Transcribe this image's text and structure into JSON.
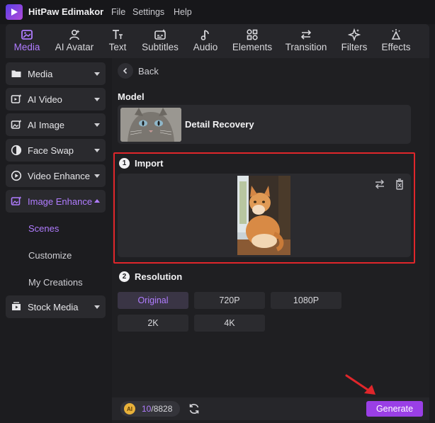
{
  "app": {
    "name": "HitPaw Edimakor"
  },
  "menu": [
    "File",
    "Settings",
    "Help"
  ],
  "tools": [
    {
      "label": "Media",
      "icon": "media-icon",
      "active": true
    },
    {
      "label": "AI Avatar",
      "icon": "ai-avatar-icon"
    },
    {
      "label": "Text",
      "icon": "text-icon"
    },
    {
      "label": "Subtitles",
      "icon": "subtitles-icon"
    },
    {
      "label": "Audio",
      "icon": "audio-icon"
    },
    {
      "label": "Elements",
      "icon": "elements-icon"
    },
    {
      "label": "Transition",
      "icon": "transition-icon"
    },
    {
      "label": "Filters",
      "icon": "filters-icon"
    },
    {
      "label": "Effects",
      "icon": "effects-icon"
    }
  ],
  "sidebar": {
    "items": [
      {
        "label": "Media",
        "icon": "folder-icon"
      },
      {
        "label": "AI Video",
        "icon": "ai-video-icon"
      },
      {
        "label": "AI Image",
        "icon": "ai-image-icon"
      },
      {
        "label": "Face Swap",
        "icon": "face-swap-icon"
      },
      {
        "label": "Video Enhance",
        "icon": "video-enhance-icon"
      },
      {
        "label": "Image Enhance",
        "icon": "image-enhance-icon",
        "expanded": true
      },
      {
        "label": "Stock Media",
        "icon": "stock-media-icon"
      }
    ],
    "sub_items": [
      "Scenes",
      "Customize",
      "My Creations"
    ],
    "active_sub": "Scenes"
  },
  "main": {
    "back_label": "Back",
    "model_title": "Model",
    "model_name": "Detail Recovery",
    "import_number": "1",
    "import_title": "Import",
    "resolution_number": "2",
    "resolution_title": "Resolution",
    "resolutions": [
      "Original",
      "720P",
      "1080P",
      "2K",
      "4K"
    ],
    "selected_resolution": "Original"
  },
  "footer": {
    "coin_label": "AI",
    "credits_used": "10",
    "credits_total": "/8828",
    "generate_label": "Generate"
  },
  "colors": {
    "accent": "#b07cff",
    "generate": "#9a3fe6",
    "highlight": "#e0262b"
  }
}
